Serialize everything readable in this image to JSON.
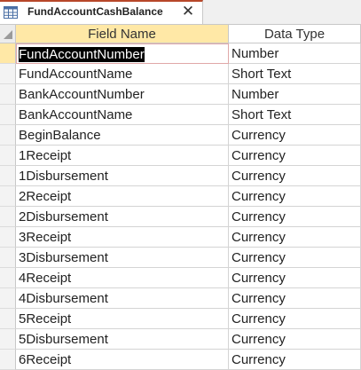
{
  "tab": {
    "title": "FundAccountCashBalance",
    "close_glyph": "✕",
    "icon": "table-icon"
  },
  "grid": {
    "headers": {
      "field_name": "Field Name",
      "data_type": "Data Type"
    },
    "rows": [
      {
        "field": "FundAccountNumber",
        "type": "Number"
      },
      {
        "field": "FundAccountName",
        "type": "Short Text"
      },
      {
        "field": "BankAccountNumber",
        "type": "Number"
      },
      {
        "field": "BankAccountName",
        "type": "Short Text"
      },
      {
        "field": "BeginBalance",
        "type": "Currency"
      },
      {
        "field": "1Receipt",
        "type": "Currency"
      },
      {
        "field": "1Disbursement",
        "type": "Currency"
      },
      {
        "field": "2Receipt",
        "type": "Currency"
      },
      {
        "field": "2Disbursement",
        "type": "Currency"
      },
      {
        "field": "3Receipt",
        "type": "Currency"
      },
      {
        "field": "3Disbursement",
        "type": "Currency"
      },
      {
        "field": "4Receipt",
        "type": "Currency"
      },
      {
        "field": "4Disbursement",
        "type": "Currency"
      },
      {
        "field": "5Receipt",
        "type": "Currency"
      },
      {
        "field": "5Disbursement",
        "type": "Currency"
      },
      {
        "field": "6Receipt",
        "type": "Currency"
      }
    ]
  },
  "colors": {
    "accent_tab": "#b7472a",
    "header_highlight": "#ffe8a6"
  }
}
